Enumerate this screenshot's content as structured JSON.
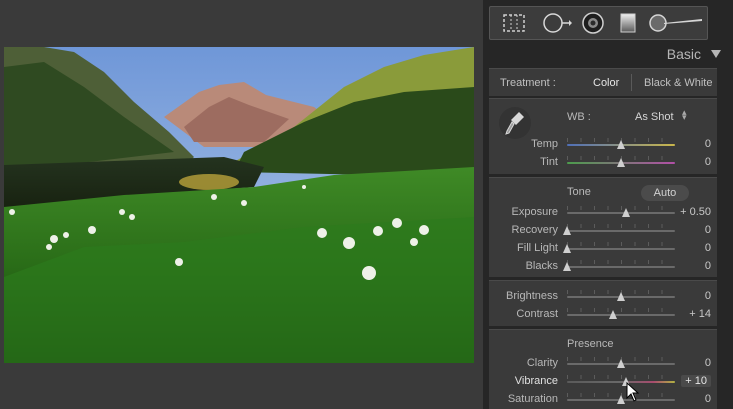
{
  "panel": {
    "title": "Basic"
  },
  "treatment": {
    "label": "Treatment :",
    "color": "Color",
    "bw": "Black & White"
  },
  "wb": {
    "label": "WB :",
    "value": "As Shot"
  },
  "wb_sliders": [
    {
      "label": "Temp",
      "value": "0",
      "pos": 0.5,
      "track": "temp"
    },
    {
      "label": "Tint",
      "value": "0",
      "pos": 0.5,
      "track": "tint"
    }
  ],
  "tone": {
    "heading": "Tone",
    "auto": "Auto"
  },
  "tone_sliders": [
    {
      "label": "Exposure",
      "value": "+ 0.50",
      "pos": 0.55
    },
    {
      "label": "Recovery",
      "value": "0",
      "pos": 0.0
    },
    {
      "label": "Fill Light",
      "value": "0",
      "pos": 0.0
    },
    {
      "label": "Blacks",
      "value": "0",
      "pos": 0.0
    }
  ],
  "bc_sliders": [
    {
      "label": "Brightness",
      "value": "0",
      "pos": 0.5
    },
    {
      "label": "Contrast",
      "value": "+ 14",
      "pos": 0.43
    }
  ],
  "presence": {
    "heading": "Presence"
  },
  "presence_sliders": [
    {
      "label": "Clarity",
      "value": "0",
      "pos": 0.5
    },
    {
      "label": "Vibrance",
      "value": "+ 10",
      "pos": 0.55,
      "track": "vib",
      "active": true
    },
    {
      "label": "Saturation",
      "value": "0",
      "pos": 0.5
    }
  ],
  "tools": [
    "crop-overlay-icon",
    "spot-removal-icon",
    "red-eye-icon",
    "graduated-filter-icon",
    "adjustment-brush-icon"
  ],
  "colors": {
    "panel_bg": "#3a3a3a",
    "text": "#b8b8b8",
    "accent_text": "#e6e6e6"
  }
}
